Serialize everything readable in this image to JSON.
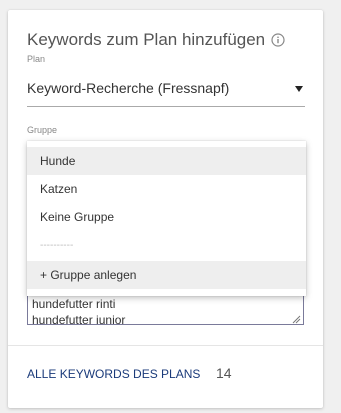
{
  "dialog": {
    "title": "Keywords zum Plan hinzufügen",
    "info_icon": "info-circle-icon"
  },
  "plan": {
    "label": "Plan",
    "value": "Keyword-Recherche (Fressnapf)",
    "caret_icon": "caret-down-icon"
  },
  "group": {
    "label": "Gruppe",
    "options": [
      {
        "label": "Hunde",
        "highlighted": true
      },
      {
        "label": "Katzen",
        "highlighted": false
      },
      {
        "label": "Keine Gruppe",
        "highlighted": false
      },
      {
        "label": "----------",
        "separator": true
      },
      {
        "label": "+ Gruppe anlegen",
        "highlighted": true
      }
    ]
  },
  "keywords_textarea": {
    "lines": [
      "hundefutter rinti",
      "hundefutter junior"
    ],
    "resize_icon": "resize-handle-icon"
  },
  "footer": {
    "link_label": "ALLE KEYWORDS DES PLANS",
    "count": "14",
    "link_color": "#1a3a7a"
  }
}
